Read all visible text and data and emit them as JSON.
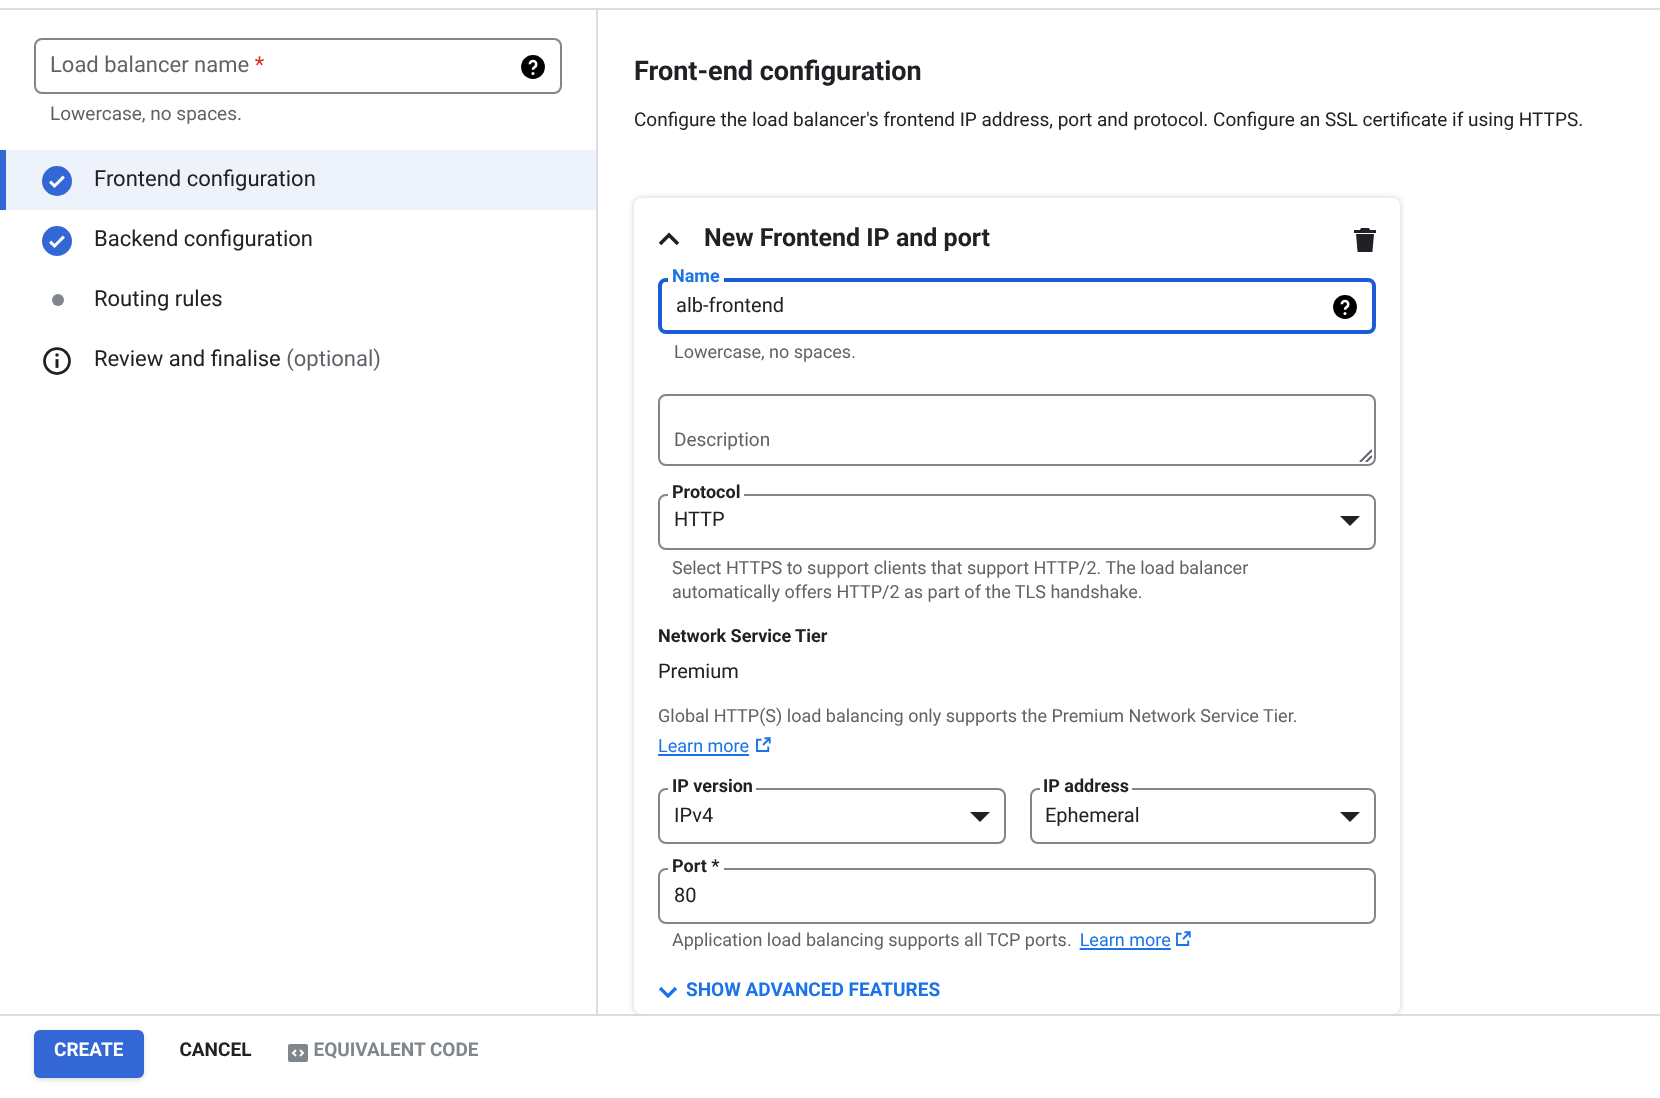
{
  "name_field": {
    "placeholder": "Load balancer name",
    "required_mark": "*",
    "hint": "Lowercase, no spaces."
  },
  "steps": [
    {
      "label": "Frontend configuration",
      "kind": "done",
      "selected": true
    },
    {
      "label": "Backend configuration",
      "kind": "done",
      "selected": false
    },
    {
      "label": "Routing rules",
      "kind": "pending",
      "selected": false
    },
    {
      "label": "Review and finalise",
      "suffix": "(optional)",
      "kind": "info",
      "selected": false
    }
  ],
  "section": {
    "title": "Front-end configuration",
    "description": "Configure the load balancer's frontend IP address, port and protocol. Configure an SSL certificate if using HTTPS."
  },
  "card": {
    "title": "New Frontend IP and port",
    "expanded": true,
    "name": {
      "label": "Name",
      "value": "alb-frontend",
      "hint": "Lowercase, no spaces."
    },
    "description": {
      "placeholder": "Description"
    },
    "protocol": {
      "label": "Protocol",
      "value": "HTTP",
      "hint": "Select HTTPS to support clients that support HTTP/2. The load balancer automatically offers HTTP/2 as part of the TLS handshake."
    },
    "tier": {
      "label": "Network Service Tier",
      "value": "Premium",
      "hint": "Global HTTP(S) load balancing only supports the Premium Network Service Tier.",
      "link": "Learn more"
    },
    "ip_version": {
      "label": "IP version",
      "value": "IPv4"
    },
    "ip_address": {
      "label": "IP address",
      "value": "Ephemeral"
    },
    "port": {
      "label": "Port *",
      "value": "80",
      "hint": "Application load balancing supports all TCP ports.",
      "link": "Learn more"
    },
    "advanced": "SHOW ADVANCED FEATURES"
  },
  "footer": {
    "create": "CREATE",
    "cancel": "CANCEL",
    "code": "EQUIVALENT CODE"
  }
}
